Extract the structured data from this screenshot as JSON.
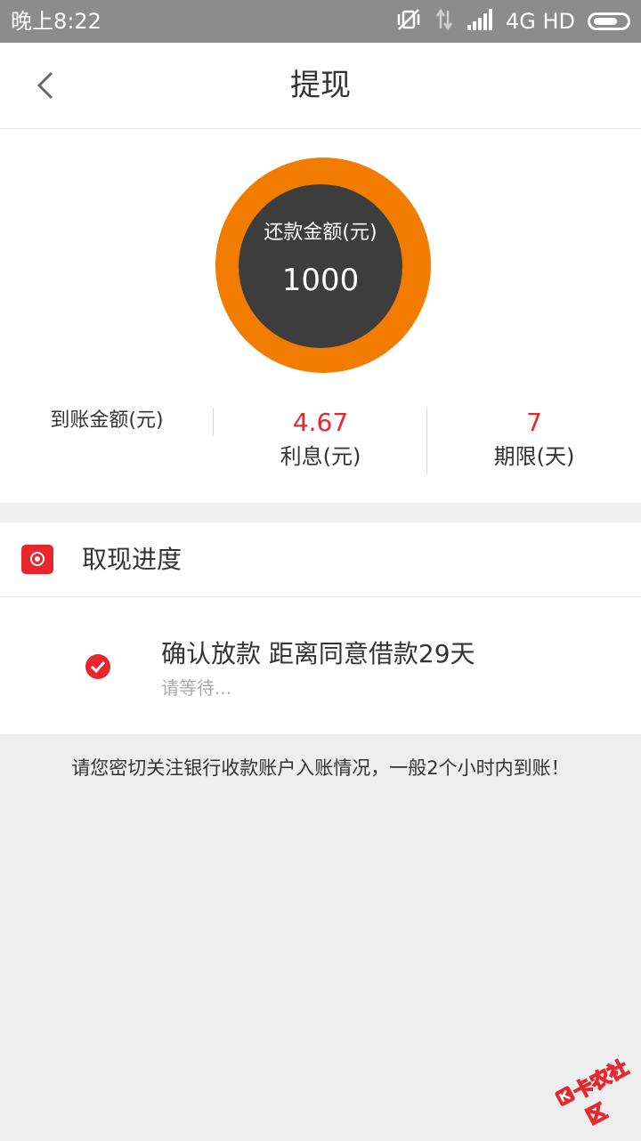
{
  "status_bar": {
    "time": "晚上8:22",
    "network": "4G HD",
    "icons": [
      "vibrate-off-icon",
      "data-transfer-icon",
      "signal-icon",
      "battery-icon"
    ]
  },
  "nav": {
    "title": "提现",
    "back_icon": "chevron-left-icon"
  },
  "summary": {
    "amount_label": "还款金额(元)",
    "amount_value": "1000",
    "arrival_label": "到账金额(元)",
    "interest_value": "4.67",
    "interest_label": "利息(元)",
    "term_value": "7",
    "term_label": "期限(天)"
  },
  "progress": {
    "title": "取现进度",
    "step_title": "确认放款 距离同意借款29天",
    "step_status": "请等待..."
  },
  "notice": "请您密切关注银行收款账户入账情况，一般2个小时内到账！",
  "watermark": "卡农社区",
  "colors": {
    "accent_red": "#e8262e",
    "ring_orange": "#f27c00",
    "ring_core": "#3d3d3d"
  }
}
